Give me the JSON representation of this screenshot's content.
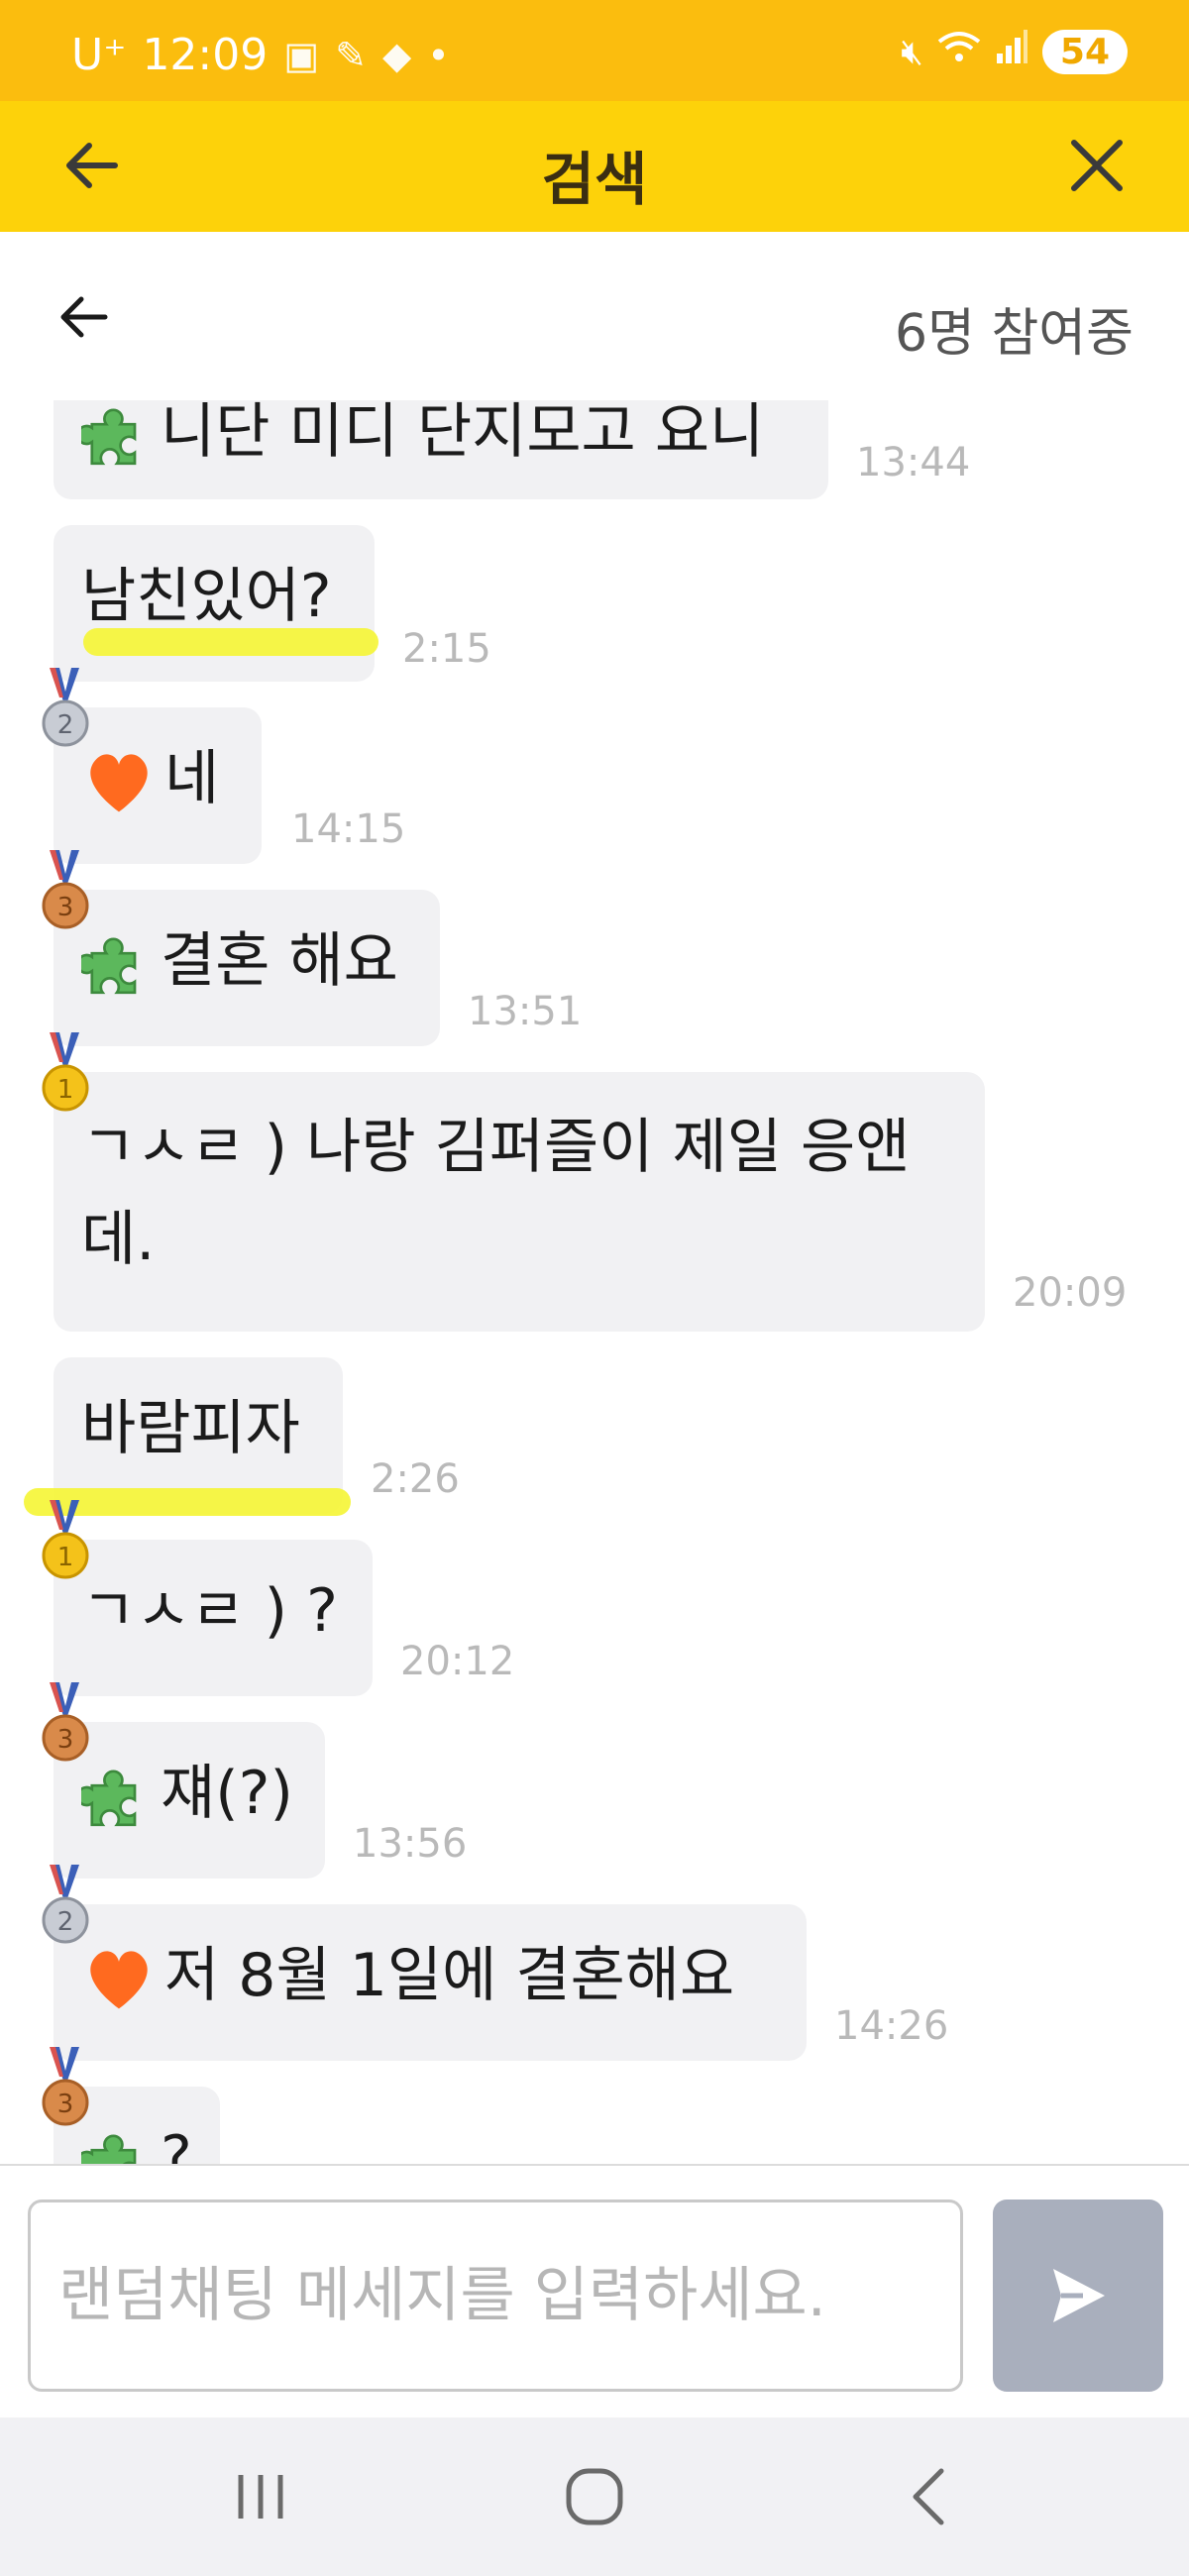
{
  "status_bar": {
    "carrier": "U⁺",
    "time": "12:09",
    "battery": "54"
  },
  "app_bar": {
    "title": "검색"
  },
  "sub_header": {
    "participants": "6명 참여중"
  },
  "messages": [
    {
      "text": "니단 미디 단지모고 요니",
      "time": "13:44",
      "medal": "bronze",
      "emoji": "puzzle"
    },
    {
      "text": "남친있어?",
      "time": "2:15",
      "medal": "none",
      "emoji": "none",
      "highlight": true
    },
    {
      "text": "네",
      "time": "14:15",
      "medal": "silver",
      "emoji": "heart"
    },
    {
      "text": "결혼 해요",
      "time": "13:51",
      "medal": "bronze",
      "emoji": "puzzle"
    },
    {
      "text": "ㄱㅅㄹ ) 나랑 김퍼즐이 제일 응앤",
      "text2": "데.",
      "time": "20:09",
      "medal": "gold",
      "emoji": "none"
    },
    {
      "text": "바람피자",
      "time": "2:26",
      "medal": "none",
      "emoji": "none",
      "highlight": true
    },
    {
      "text": "ㄱㅅㄹ ) ?",
      "time": "20:12",
      "medal": "gold",
      "emoji": "none"
    },
    {
      "text": "쟤(?)",
      "time": "13:56",
      "medal": "bronze",
      "emoji": "puzzle"
    },
    {
      "text": "저 8월 1일에 결혼해요",
      "time": "14:26",
      "medal": "silver",
      "emoji": "heart"
    },
    {
      "text": "?",
      "time": "",
      "medal": "bronze",
      "emoji": "puzzle"
    }
  ],
  "input": {
    "placeholder": "랜덤채팅 메세지를 입력하세요."
  },
  "colors": {
    "status_bar": "#fbbd0e",
    "app_bar": "#fdd20a",
    "bubble": "#f1f1f3",
    "send_button": "#a9afbd",
    "highlight": "#f5f534"
  },
  "icons": {
    "app_back": "arrow-left-icon",
    "app_close": "close-icon",
    "sub_back": "arrow-left-icon",
    "send": "send-icon",
    "nav_recents": "recents-icon",
    "nav_home": "home-icon",
    "nav_back": "back-icon"
  }
}
